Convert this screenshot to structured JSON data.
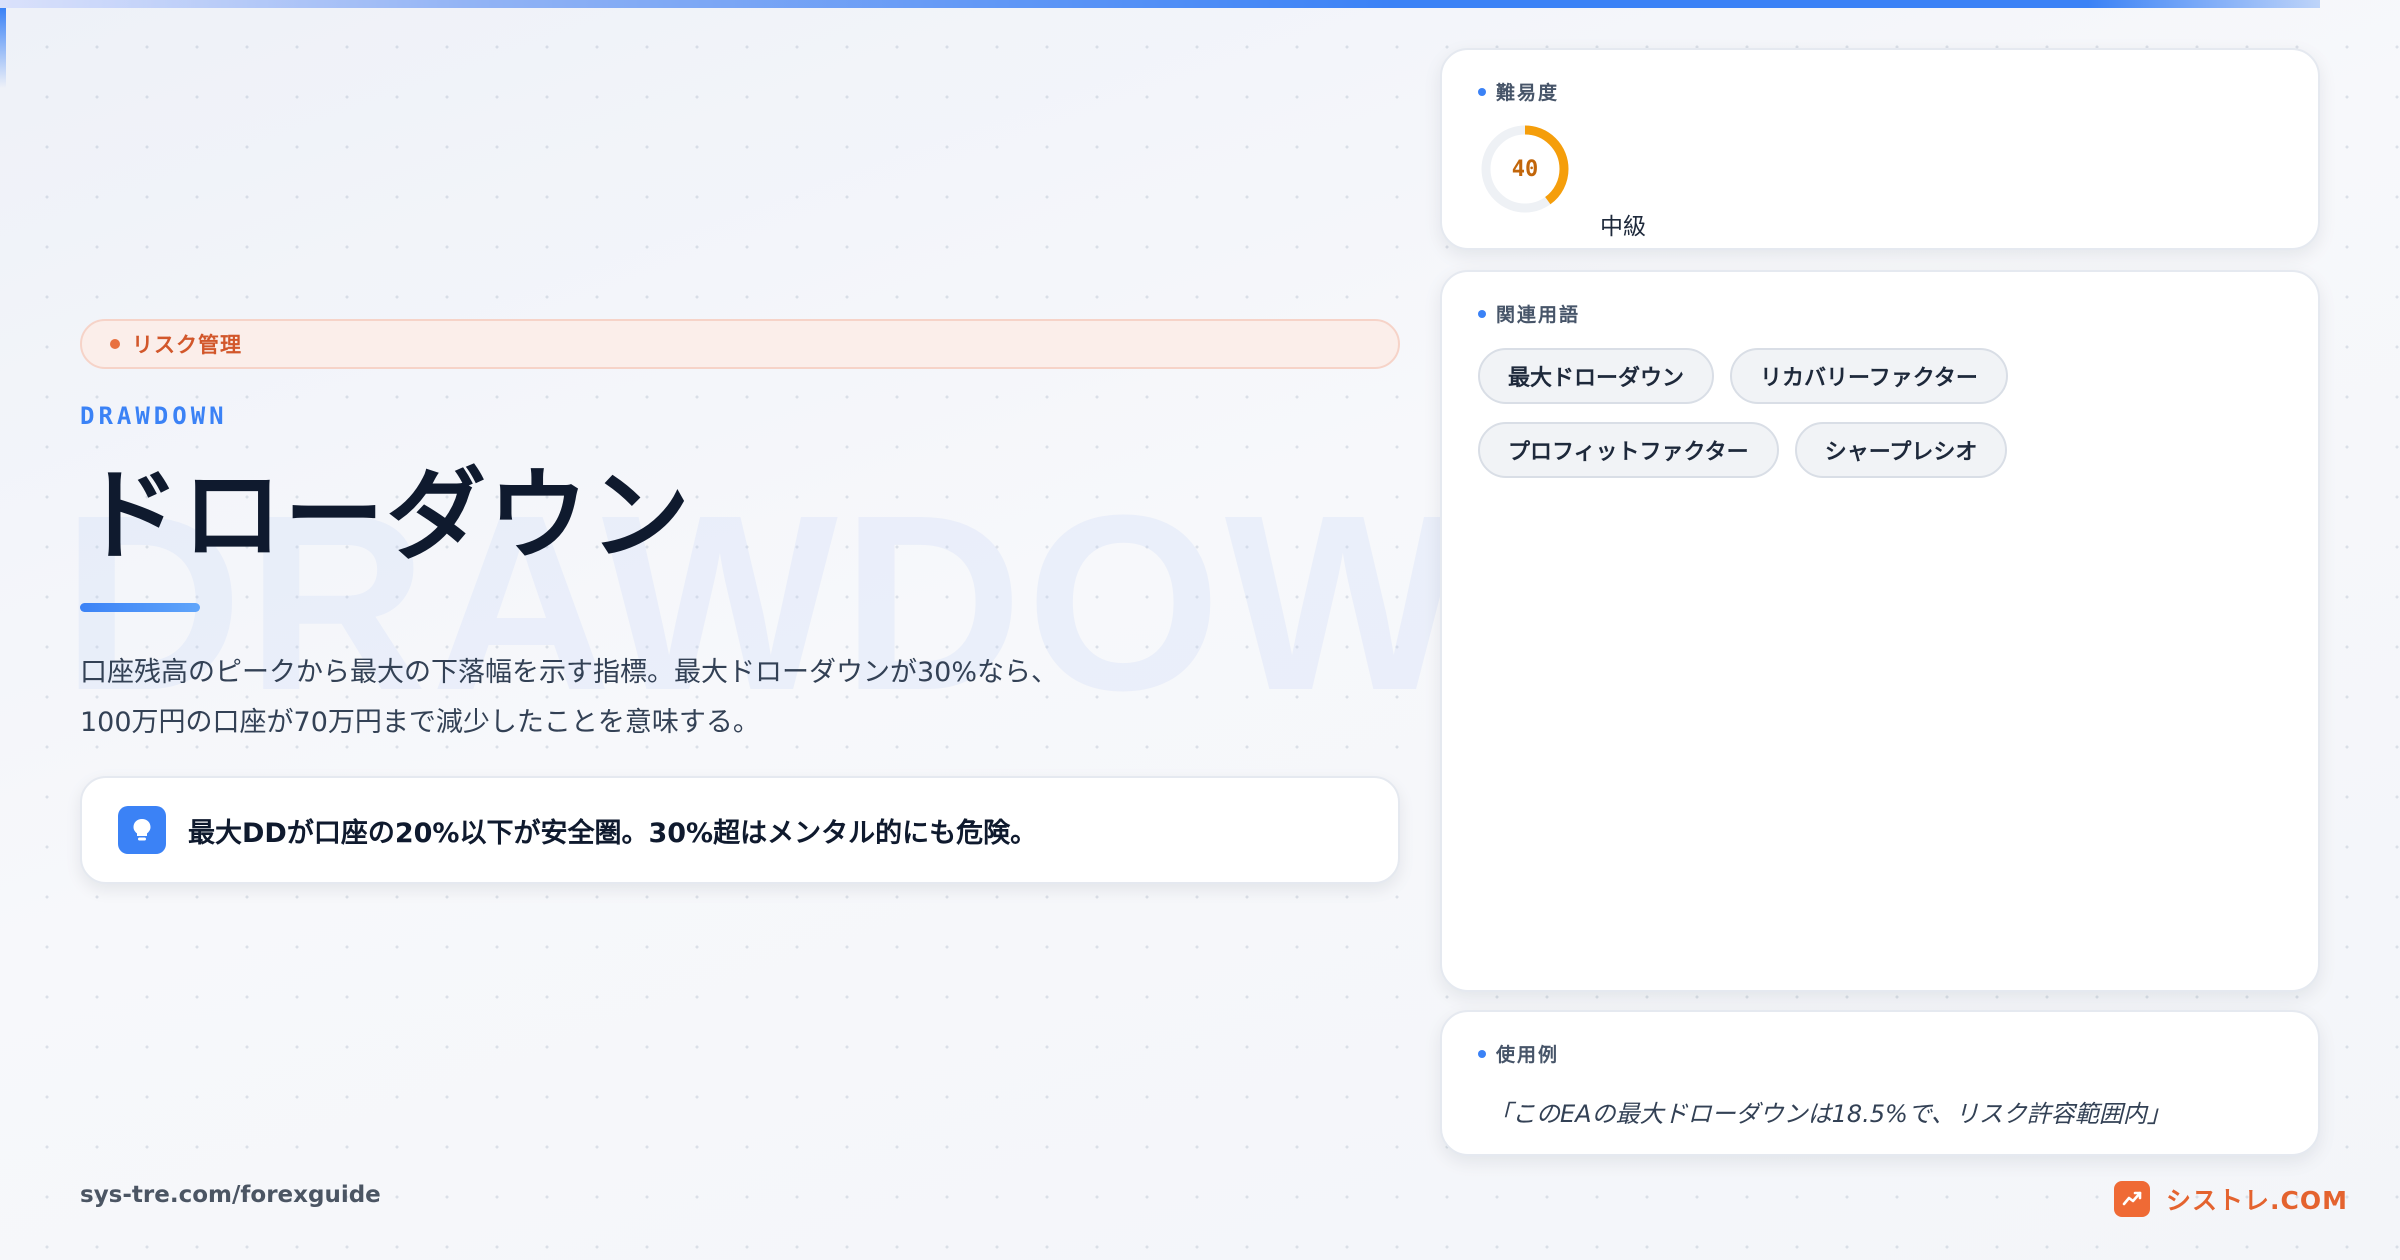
{
  "category": {
    "label": "リスク管理"
  },
  "term": {
    "english": "DRAWDOWN",
    "watermark": "DRAWDOWN",
    "title": "ドローダウン",
    "description_lines": [
      "口座残高のピークから最大の下落幅を示す指標。最大ドローダウンが30%なら、",
      "100万円の口座が70万円まで減少したことを意味する。"
    ]
  },
  "tip": {
    "icon": "lightbulb-icon",
    "text": "最大DDが口座の20%以下が安全圏。30%超はメンタル的にも危険。"
  },
  "difficulty": {
    "label": "難易度",
    "score": 40,
    "max": 100,
    "level": "中級",
    "color": "#f59e0b"
  },
  "related": {
    "label": "関連用語",
    "terms": [
      "最大ドローダウン",
      "リカバリーファクター",
      "プロフィットファクター",
      "シャープレシオ"
    ]
  },
  "example": {
    "label": "使用例",
    "text": "「このEAの最大ドローダウンは18.5%で、リスク許容範囲内」"
  },
  "footer": {
    "url": "sys-tre.com/forexguide",
    "brand": "シストレ.COM",
    "brand_icon": "chart-up-icon"
  },
  "colors": {
    "accent": "#3b82f6",
    "brand": "#e4632f",
    "category": "#d2572b"
  }
}
